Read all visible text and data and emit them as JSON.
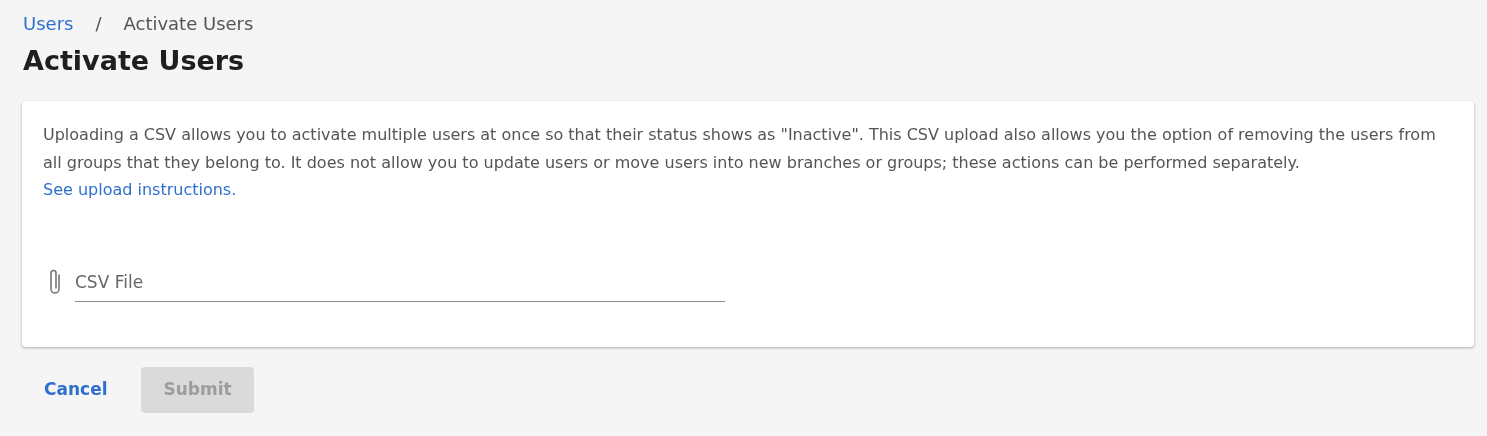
{
  "breadcrumb": [
    {
      "label": "Users",
      "link": true
    },
    {
      "label": "Activate Users",
      "link": false
    }
  ],
  "breadcrumb_separator": "/",
  "title": "Activate Users",
  "description": {
    "text": "Uploading a CSV allows you to activate multiple users at once so that their status shows as \"Inactive\". This CSV upload also allows you the option of removing the users from all groups that they belong to. It does not allow you to update users or move users into new branches or groups; these actions can be performed separately.",
    "link": "See upload instructions."
  },
  "file_field": {
    "placeholder": "CSV File"
  },
  "buttons": [
    {
      "label": "Cancel",
      "kind": "link",
      "disabled": false
    },
    {
      "label": "Submit",
      "kind": "solid",
      "disabled": true
    }
  ]
}
